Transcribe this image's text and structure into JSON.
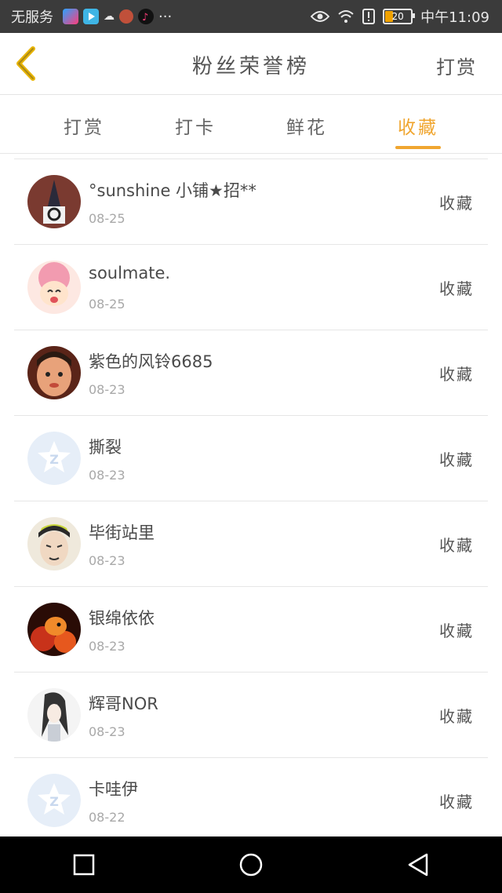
{
  "status_bar": {
    "carrier": "无服务",
    "time": "中午11:09",
    "battery": "20",
    "icons": [
      "youku-app-icon",
      "video-app-icon",
      "weather-icon",
      "lion-app-icon",
      "tiktok-icon",
      "more-dots-icon",
      "eye-icon",
      "wifi-icon",
      "alert-icon",
      "battery-icon"
    ]
  },
  "navbar": {
    "title": "粉丝荣誉榜",
    "action": "打赏",
    "back_icon": "chevron-left-icon"
  },
  "tabs": [
    {
      "label": "打赏",
      "active": false
    },
    {
      "label": "打卡",
      "active": false
    },
    {
      "label": "鲜花",
      "active": false
    },
    {
      "label": "收藏",
      "active": true
    }
  ],
  "fans": [
    {
      "name": "°sunshine 小铺★招**",
      "date": "08-25",
      "action": "收藏",
      "avatar": "photo"
    },
    {
      "name": "soulmate.",
      "date": "08-25",
      "action": "收藏",
      "avatar": "anime-pink"
    },
    {
      "name": "紫色的风铃6685",
      "date": "08-23",
      "action": "收藏",
      "avatar": "child"
    },
    {
      "name": "撕裂",
      "date": "08-23",
      "action": "收藏",
      "avatar": "default"
    },
    {
      "name": "毕街站里",
      "date": "08-23",
      "action": "收藏",
      "avatar": "cartoon"
    },
    {
      "name": "银绵依依",
      "date": "08-23",
      "action": "收藏",
      "avatar": "fire"
    },
    {
      "name": "辉哥NOR",
      "date": "08-23",
      "action": "收藏",
      "avatar": "sketch"
    },
    {
      "name": "卡哇伊",
      "date": "08-22",
      "action": "收藏",
      "avatar": "default"
    }
  ],
  "colors": {
    "accent": "#f0a630",
    "status_bar": "#3b3b3b",
    "back_arrow": "#e8b400"
  }
}
